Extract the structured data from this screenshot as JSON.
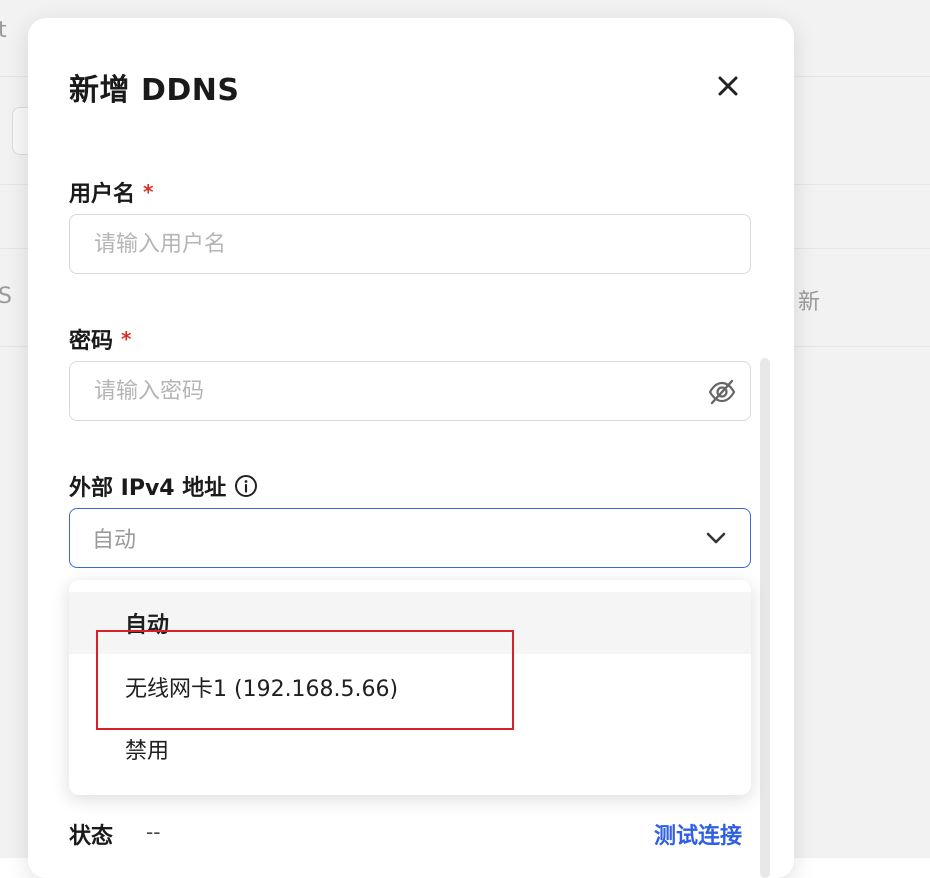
{
  "background": {
    "fragments": [
      "t",
      "S",
      "新"
    ]
  },
  "modal": {
    "title": "新增 DDNS",
    "close_icon": "close-icon",
    "username": {
      "label": "用户名",
      "required": "*",
      "placeholder": "请输入用户名",
      "value": ""
    },
    "password": {
      "label": "密码",
      "required": "*",
      "placeholder": "请输入密码",
      "value": "",
      "toggle_icon": "eye-off-icon"
    },
    "ipv4": {
      "label": "外部 IPv4 地址",
      "info_icon": "info-icon",
      "selected": "自动",
      "chevron_icon": "chevron-down-icon",
      "options": [
        "自动",
        "无线网卡1 (192.168.5.66)",
        "禁用"
      ]
    },
    "status": {
      "label": "状态",
      "value": "--"
    },
    "test_link": "测试连接"
  },
  "colors": {
    "accent": "#2f5fe3",
    "select_border": "#3b66e0",
    "required": "#d93026",
    "highlight": "#d6202a"
  }
}
